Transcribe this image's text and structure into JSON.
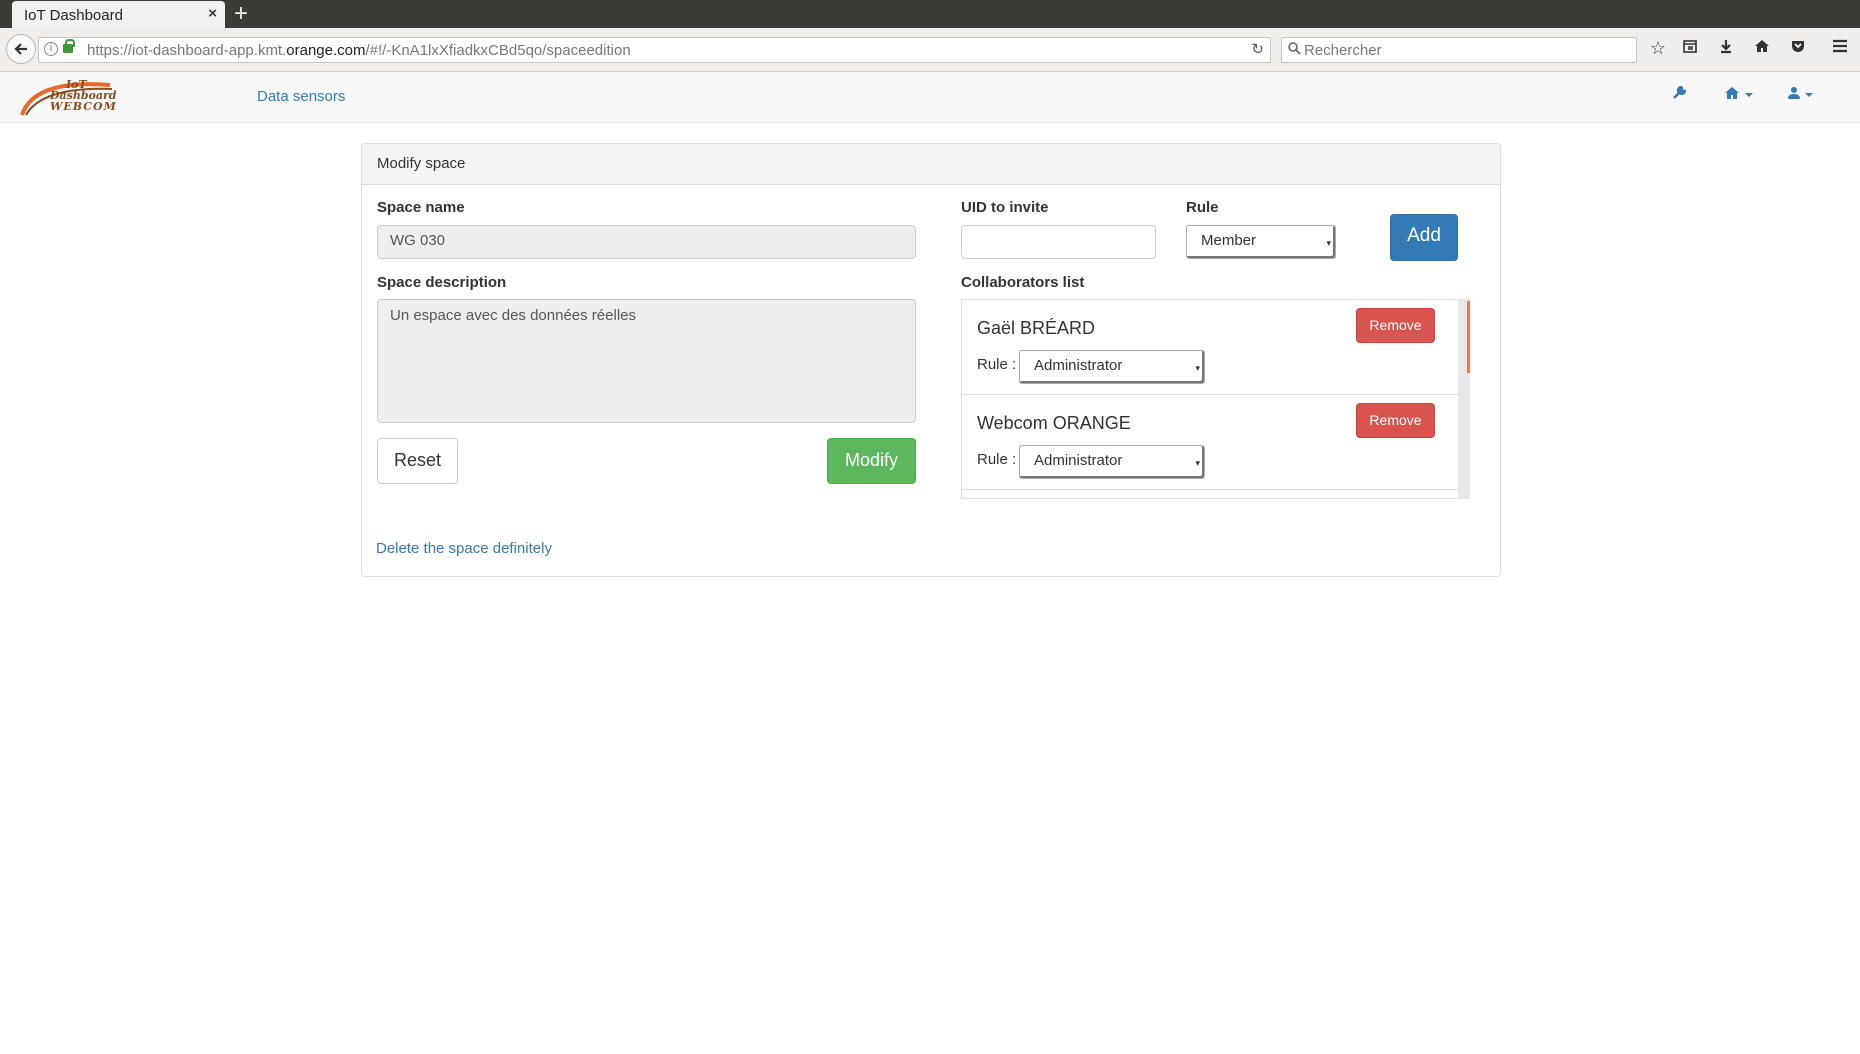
{
  "browser": {
    "tab_title": "IoT Dashboard",
    "tab_close": "×",
    "new_tab": "+",
    "url_prefix": "https://iot-dashboard-app.kmt.",
    "url_domain": "orange.com",
    "url_suffix": "/#!/-KnA1lxXfiadkxCBd5qo/spaceedition",
    "search_placeholder": "Rechercher"
  },
  "app": {
    "logo_lines": [
      "IoT",
      "Dashboard",
      "WEBCOM"
    ],
    "nav_link": "Data sensors",
    "header_icons": [
      "wrench-icon",
      "home-icon",
      "user-icon"
    ]
  },
  "panel": {
    "heading": "Modify space",
    "space_name_label": "Space name",
    "space_name_value": "WG 030",
    "space_description_label": "Space description",
    "space_description_value": "Un espace avec des données réelles",
    "reset_label": "Reset",
    "modify_label": "Modify",
    "uid_label": "UID to invite",
    "uid_value": "",
    "rule_label": "Rule",
    "rule_value": "Member",
    "add_label": "Add",
    "collaborators_label": "Collaborators list",
    "collaborators": [
      {
        "name": "Gaël BRÉARD",
        "rule_label": "Rule :",
        "rule": "Administrator",
        "remove_label": "Remove"
      },
      {
        "name": "Webcom ORANGE",
        "rule_label": "Rule :",
        "rule": "Administrator",
        "remove_label": "Remove"
      }
    ],
    "delete_link": "Delete the space definitely"
  },
  "colors": {
    "primary": "#337ab7",
    "success": "#5cb85c",
    "danger": "#d9534f",
    "scroll_thumb": "#f07746"
  }
}
